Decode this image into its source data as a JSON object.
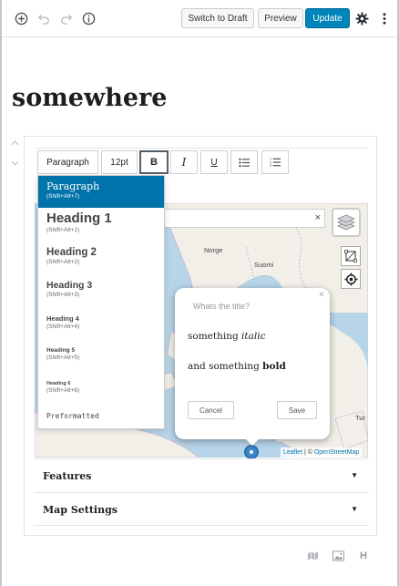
{
  "topbar": {
    "switch_draft_label": "Switch to Draft",
    "preview_label": "Preview",
    "update_label": "Update"
  },
  "post": {
    "title": "somewhere"
  },
  "toolbar": {
    "block_format": "Paragraph",
    "font_size": "12pt",
    "bold_label": "B",
    "italic_label": "I",
    "underline_label": "U"
  },
  "format_menu": {
    "items": [
      {
        "label": "Paragraph",
        "shortcut": "(Shift+Alt+7)"
      },
      {
        "label": "Heading 1",
        "shortcut": "(Shift+Alt+1)"
      },
      {
        "label": "Heading 2",
        "shortcut": "(Shift+Alt+2)"
      },
      {
        "label": "Heading 3",
        "shortcut": "(Shift+Alt+3)"
      },
      {
        "label": "Heading 4",
        "shortcut": "(Shift+Alt+4)"
      },
      {
        "label": "Heading 5",
        "shortcut": "(Shift+Alt+5)"
      },
      {
        "label": "Heading 6",
        "shortcut": "(Shift+Alt+6)"
      },
      {
        "label": "Preformatted",
        "shortcut": ""
      }
    ],
    "selected_index": 0
  },
  "map": {
    "labels": {
      "norge": "Norge",
      "suomi": "Suomi",
      "tur": "Tur"
    },
    "search_clear": "×",
    "attribution": {
      "leaflet": "Leaflet",
      "sep": " | © ",
      "osm": "OpenStreetMap"
    }
  },
  "popup": {
    "close": "×",
    "title_placeholder": "Whats the title?",
    "line1_prefix": "something ",
    "line1_italic": "italic",
    "line2_prefix": "and something ",
    "line2_bold": "bold",
    "cancel_label": "Cancel",
    "save_label": "Save"
  },
  "panels": {
    "features": "Features",
    "map_settings": "Map Settings",
    "arrow": "▼"
  },
  "bottom": {
    "heading_label": "H"
  },
  "colors": {
    "accent": "#0085ba",
    "selected": "#0073aa",
    "water": "#b7d4e8",
    "land": "#f2efe9"
  }
}
